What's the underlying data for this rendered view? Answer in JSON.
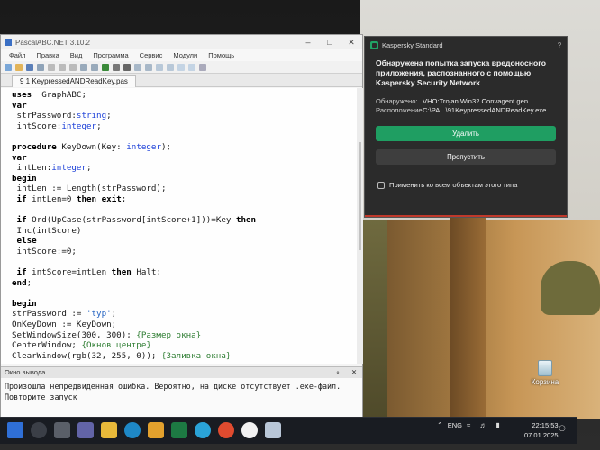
{
  "ide": {
    "title": "PascalABC.NET 3.10.2",
    "menu": [
      "Файл",
      "Правка",
      "Вид",
      "Программа",
      "Сервис",
      "Модули",
      "Помощь"
    ],
    "tab": "9 1 KeypressedANDReadKey.pas",
    "code": [
      [
        [
          "kw",
          "uses"
        ],
        [
          "",
          "  GraphABC;"
        ]
      ],
      [
        [
          "kw",
          "var"
        ]
      ],
      [
        [
          "",
          " strPassword:"
        ],
        [
          "ty",
          "string"
        ],
        [
          "",
          ";"
        ]
      ],
      [
        [
          "",
          " intScore:"
        ],
        [
          "ty",
          "integer"
        ],
        [
          "",
          ";"
        ]
      ],
      [
        [
          "",
          ""
        ]
      ],
      [
        [
          "kw",
          "procedure"
        ],
        [
          "",
          " KeyDown(Key: "
        ],
        [
          "ty",
          "integer"
        ],
        [
          "",
          ");"
        ]
      ],
      [
        [
          "kw",
          "var"
        ]
      ],
      [
        [
          "",
          " intLen:"
        ],
        [
          "ty",
          "integer"
        ],
        [
          "",
          ";"
        ]
      ],
      [
        [
          "kw",
          "begin"
        ]
      ],
      [
        [
          "",
          " intLen := Length(strPassword);"
        ]
      ],
      [
        [
          "",
          " "
        ],
        [
          "kw",
          "if"
        ],
        [
          "",
          " intLen=0 "
        ],
        [
          "kw",
          "then"
        ],
        [
          "kw",
          " exit"
        ],
        [
          "",
          ";"
        ]
      ],
      [
        [
          "",
          ""
        ]
      ],
      [
        [
          "",
          " "
        ],
        [
          "kw",
          "if"
        ],
        [
          "",
          " Ord(UpCase(strPassword[intScore+1]))=Key "
        ],
        [
          "kw",
          "then"
        ]
      ],
      [
        [
          "",
          " Inc(intScore)"
        ]
      ],
      [
        [
          "",
          " "
        ],
        [
          "kw",
          "else"
        ]
      ],
      [
        [
          "",
          " intScore:=0;"
        ]
      ],
      [
        [
          "",
          ""
        ]
      ],
      [
        [
          "",
          " "
        ],
        [
          "kw",
          "if"
        ],
        [
          "",
          " intScore=intLen "
        ],
        [
          "kw",
          "then"
        ],
        [
          "",
          " Halt;"
        ]
      ],
      [
        [
          "kw",
          "end"
        ],
        [
          "",
          ";"
        ]
      ],
      [
        [
          "",
          ""
        ]
      ],
      [
        [
          "kw",
          "begin"
        ]
      ],
      [
        [
          "",
          "strPassword := "
        ],
        [
          "st",
          "'typ'"
        ],
        [
          "",
          ";"
        ]
      ],
      [
        [
          "",
          "OnKeyDown := KeyDown;"
        ]
      ],
      [
        [
          "",
          "SetWindowSize(300, 300); "
        ],
        [
          "cm",
          "{Размер окна}"
        ]
      ],
      [
        [
          "",
          "CenterWindow; "
        ],
        [
          "cm",
          "{Окнов центре}"
        ]
      ],
      [
        [
          "",
          "ClearWindow(rgb(32, 255, 0)); "
        ],
        [
          "cm",
          "{Заливка окна}"
        ]
      ]
    ],
    "output": {
      "header": "Окно вывода",
      "lines": [
        "Произошла непредвиденная ошибка. Вероятно, на диске отсутствует .exe-файл.",
        "Повторите запуск"
      ]
    }
  },
  "kaspersky": {
    "product": "Kaspersky Standard",
    "message": "Обнаружена попытка запуска вредоносного приложения, распознанного с помощью Kaspersky Security Network",
    "detected_label": "Обнаружено:",
    "detected_value": "VHO:Trojan.Win32.Convagent.gen",
    "location_label": "Расположение:",
    "location_value": "C:\\PA...\\91KeypressedANDReadKey.exe",
    "delete_button": "Удалить",
    "skip_button": "Пропустить",
    "apply_all": "Применить ко всем объектам этого типа",
    "accent_color": "#1f9e62"
  },
  "desktop": {
    "recycle_bin": "Корзина"
  },
  "taskbar": {
    "lang": "ENG",
    "time": "22:15:53",
    "date": "07.01.2025"
  }
}
